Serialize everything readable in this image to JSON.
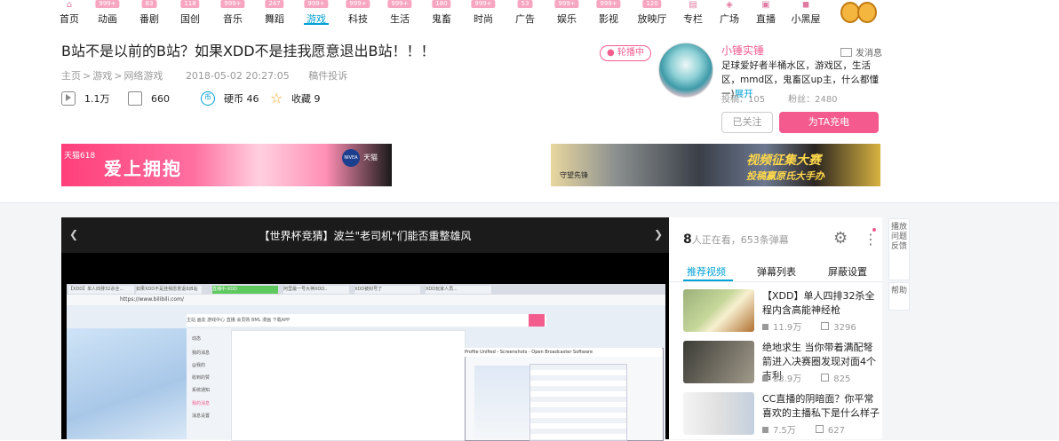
{
  "nav": {
    "items": [
      {
        "label": "首页",
        "badge": "",
        "icon": "home-icon"
      },
      {
        "label": "动画",
        "badge": "999+",
        "icon": ""
      },
      {
        "label": "番剧",
        "badge": "83",
        "icon": ""
      },
      {
        "label": "国创",
        "badge": "118",
        "icon": ""
      },
      {
        "label": "音乐",
        "badge": "999+",
        "icon": ""
      },
      {
        "label": "舞蹈",
        "badge": "247",
        "icon": ""
      },
      {
        "label": "游戏",
        "badge": "999+",
        "icon": ""
      },
      {
        "label": "科技",
        "badge": "999+",
        "icon": ""
      },
      {
        "label": "生活",
        "badge": "999+",
        "icon": ""
      },
      {
        "label": "鬼畜",
        "badge": "180",
        "icon": ""
      },
      {
        "label": "时尚",
        "badge": "999+",
        "icon": ""
      },
      {
        "label": "广告",
        "badge": "53",
        "icon": ""
      },
      {
        "label": "娱乐",
        "badge": "999+",
        "icon": ""
      },
      {
        "label": "影视",
        "badge": "999+",
        "icon": ""
      },
      {
        "label": "放映厅",
        "badge": "120",
        "icon": ""
      },
      {
        "label": "专栏",
        "badge": "",
        "icon": "column-icon"
      },
      {
        "label": "广场",
        "badge": "",
        "icon": "square-icon"
      },
      {
        "label": "直播",
        "badge": "",
        "icon": "live-icon"
      },
      {
        "label": "小黑屋",
        "badge": "",
        "icon": "blackroom-icon"
      }
    ]
  },
  "video": {
    "title": "B站不是以前的B站？如果XDD不是挂我愿意退出B站！！！",
    "breadcrumb": [
      "主页",
      "游戏",
      "网络游戏"
    ],
    "breadcrumb_sep": ">",
    "date": "2018-05-02 20:27:05",
    "report": "稿件投诉",
    "plays": "1.1万",
    "danmaku": "660",
    "coins": "硬币 46",
    "favorites": "收藏 9"
  },
  "ads": {
    "left_tag": "天猫618",
    "left_main": "爱上拥抱",
    "left_brand": "NIVEA",
    "left_tm": "天猫",
    "right_main": "视频征集大赛",
    "right_sub": "投稿赢原氏大手办",
    "right_logo": "守望先锋"
  },
  "uploader": {
    "live_badge": "轮播中",
    "name": "小锤实锤",
    "message": "发消息",
    "desc": "足球爱好者半桶水区，游戏区，生活区，mmd区，鬼畜区up主，什么都懂一)",
    "expand": "展开",
    "posts": "投稿：105",
    "fans": "粉丝：2480",
    "followed": "已关注",
    "charge": "为TA充电"
  },
  "player": {
    "title": "【世界杯竞猜】波兰\"老司机\"们能否重整雄风",
    "screen": {
      "tabs": [
        "【XDD】单人四排32杀全...",
        "如果XDD不是挂我愿意退出B站",
        "直播中-XDD",
        "阿里最一号大神XDD..",
        "XDD被封号了",
        "XDD玩家人员..."
      ],
      "address": "https://www.bilibili.com/",
      "nav": "主站  画友  游戏中心  直播  会员购  BML  漫画  下载APP",
      "menu": [
        "动态",
        "我的消息",
        "@我的",
        "收到的赞",
        "系统通知",
        "我的消息",
        "消息设置"
      ],
      "window_title": "Profile Unified - Screenshots - Open Broadcaster Software"
    }
  },
  "sidebar": {
    "watching_count": "8",
    "watching_text": "人正在看，653条弹幕",
    "tabs": [
      "推荐视频",
      "弹幕列表",
      "屏蔽设置"
    ],
    "recs": [
      {
        "title": "【XDD】单人四排32杀全程内含高能神经枪",
        "plays": "11.9万",
        "danmaku": "3296"
      },
      {
        "title": "绝地求生 当你带着满配弩箭进入决赛圈发现对面4个吉利",
        "plays": "33.9万",
        "danmaku": "825"
      },
      {
        "title": "CC直播的阴暗面？你平常喜欢的主播私下是什么样子",
        "plays": "7.5万",
        "danmaku": "627"
      }
    ]
  },
  "float": {
    "feedback": "播放问题反馈",
    "help": "帮助"
  },
  "colors": {
    "accent": "#00a1d6",
    "pink": "#f25d8e"
  }
}
